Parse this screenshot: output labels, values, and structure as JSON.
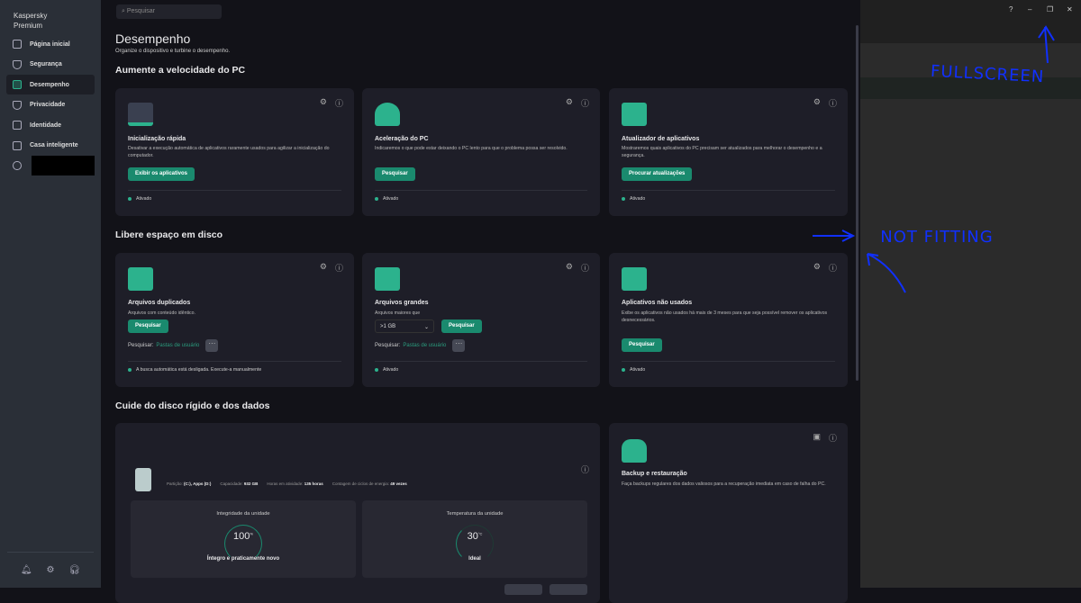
{
  "sidebar": {
    "brand": "Kaspersky Premium",
    "items": [
      {
        "label": "Página inicial"
      },
      {
        "label": "Segurança"
      },
      {
        "label": "Desempenho"
      },
      {
        "label": "Privacidade"
      },
      {
        "label": "Identidade"
      },
      {
        "label": "Casa inteligente"
      }
    ],
    "active": "Desempenho"
  },
  "search": {
    "placeholder": "Pesquisar"
  },
  "page": {
    "title": "Desempenho",
    "subtitle": "Organize o dispositivo e turbine o desempenho."
  },
  "sections": {
    "speed": "Aumente a velocidade do PC",
    "disk": "Libere espaço em disco",
    "care": "Cuide do disco rígido e dos dados"
  },
  "cards": {
    "startup": {
      "title": "Inicialização rápida",
      "desc": "Desativar a execução automática de aplicativos raramente usados para agilizar a inicialização do computador.",
      "button": "Exibir os aplicativos",
      "status": "Ativado"
    },
    "accel": {
      "title": "Aceleração do PC",
      "desc": "Indicaremos o que pode estar deixando o PC lento para que o problema possa ser resolvido.",
      "button": "Pesquisar",
      "status": "Ativado"
    },
    "updater": {
      "title": "Atualizador de aplicativos",
      "desc": "Mostraremos quais aplicativos do PC precisam ser atualizados para melhorar o desempenho e a segurança.",
      "button": "Procurar atualizações",
      "status": "Ativado"
    },
    "dupes": {
      "title": "Arquivos duplicados",
      "desc": "Arquivos com conteúdo idêntico.",
      "button": "Pesquisar",
      "search_label": "Pesquisar:",
      "search_link": "Pastas de usuário",
      "status": "A busca automática está desligada. Execute-a manualmente"
    },
    "large": {
      "title": "Arquivos grandes",
      "desc": "Arquivos maiores que",
      "select": ">1 GB",
      "button": "Pesquisar",
      "search_label": "Pesquisar:",
      "search_link": "Pastas de usuário",
      "status": "Ativado"
    },
    "unused": {
      "title": "Aplicativos não usados",
      "desc": "Exibe os aplicativos não usados há mais de 3 meses para que seja possível remover os aplicativos desnecessários.",
      "button": "Pesquisar",
      "status": "Ativado"
    },
    "disk": {
      "partition_label": "Partição:",
      "partition": "(C:), Apps (D:)",
      "capacity_label": "Capacidade:",
      "capacity": "932 GB",
      "hours_label": "Horas em atividade:",
      "hours": "135 horas",
      "cycles_label": "Contagem de ciclos de energia:",
      "cycles": "49 vezes",
      "integrity_title": "Integridade da unidade",
      "integrity_value": "100",
      "integrity_unit": "%",
      "integrity_status": "Íntegro e praticamente novo",
      "temp_title": "Temperatura da unidade",
      "temp_value": "30",
      "temp_unit": "°C",
      "temp_status": "Ideal"
    },
    "backup": {
      "title": "Backup e restauração",
      "desc": "Faça backups regulares dos dados valiosos para a recuperação imediata em caso de falha do PC."
    }
  },
  "window": {
    "help": "?",
    "minimize": "–",
    "restore": "❐",
    "close": "✕"
  },
  "annotations": {
    "fullscreen": "FULLSCREEN",
    "not_fitting": "NOT FITTING"
  },
  "colors": {
    "accent": "#1a8a6e",
    "annotation": "#1030ff"
  }
}
